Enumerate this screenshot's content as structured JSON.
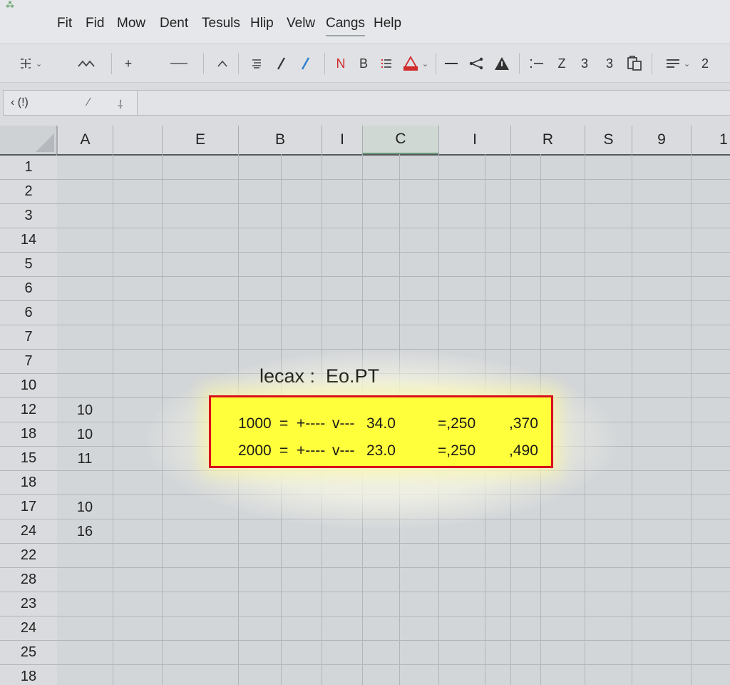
{
  "menu": [
    "Fit",
    "Fid",
    "Mow",
    "Dent",
    "Tesuls",
    "Hlip",
    "Velw",
    "Cangs",
    "Help"
  ],
  "toolbar": {
    "font_red_label": "N",
    "bold_label": "B",
    "z_label": "Z",
    "three_a": "3",
    "three_b": "3",
    "two_label": "2"
  },
  "formula_bar": {
    "name_box": "‹  (!)"
  },
  "columns": [
    "A",
    "",
    "E",
    "B",
    "I",
    "C",
    "I",
    "R",
    "S",
    "9",
    "1"
  ],
  "selected_column": "C",
  "rows": [
    "1",
    "2",
    "3",
    "14",
    "5",
    "6",
    "6",
    "7",
    "7",
    "10",
    "12",
    "18",
    "15",
    "18",
    "17",
    "24",
    "22",
    "28",
    "23",
    "24",
    "25",
    "18"
  ],
  "column_a_values": [
    "",
    "",
    "",
    "",
    "",
    "",
    "",
    "",
    "",
    "",
    "10",
    "10",
    "11",
    "",
    "10",
    "16",
    "",
    "",
    "",
    "",
    "",
    ""
  ],
  "callout": {
    "label": "lecax :  Eo.PT",
    "rows": [
      {
        "a": "1000",
        "b": "=",
        "c": "+----",
        "d": "v---",
        "e": "34.0",
        "f": "=,250",
        "g": ",370"
      },
      {
        "a": "2000",
        "b": "=",
        "c": "+----",
        "d": "v---",
        "e": "23.0",
        "f": "=,250",
        "g": ",490"
      }
    ]
  },
  "colors": {
    "highlight_fill": "#ffff3c",
    "highlight_border": "#d9121b",
    "selected_column_accent": "#6a9a78"
  }
}
